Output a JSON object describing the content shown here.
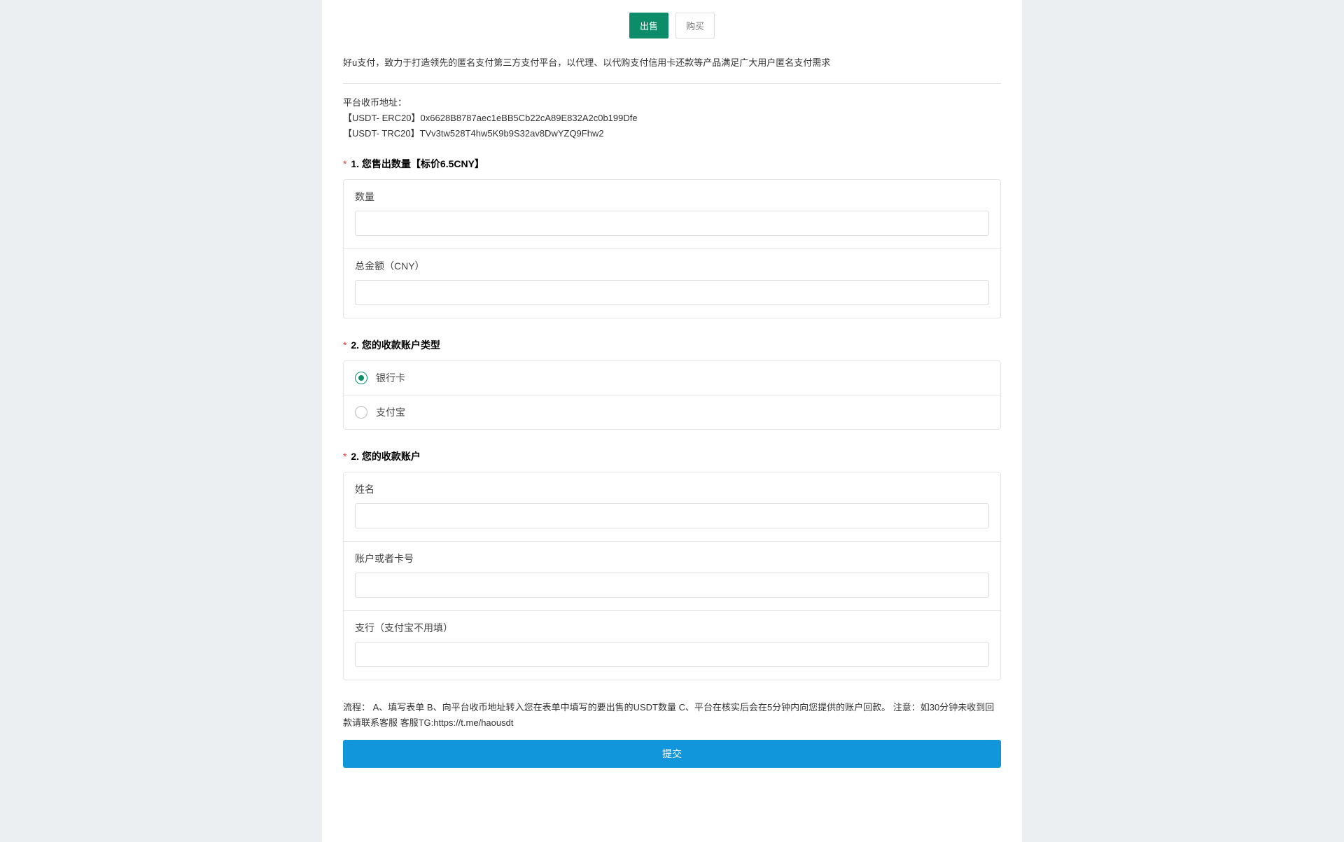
{
  "tabs": {
    "sell": "出售",
    "buy": "购买"
  },
  "intro": "好u支付，致力于打造领先的匿名支付第三方支付平台，以代理、以代购支付信用卡还款等产品满足广大用户匿名支付需求",
  "address": {
    "title": "平台收币地址：",
    "line1": "【USDT- ERC20】0x6628B8787aec1eBB5Cb22cA89E832A2c0b199Dfe",
    "line2": "【USDT- TRC20】TVv3tw528T4hw5K9b9S32av8DwYZQ9Fhw2"
  },
  "sections": {
    "s1": {
      "title": "1. 您售出数量【标价6.5CNY】",
      "fields": {
        "qty": "数量",
        "total": "总金额（CNY）"
      }
    },
    "s2": {
      "title": "2. 您的收款账户类型",
      "options": {
        "bank": "银行卡",
        "alipay": "支付宝"
      }
    },
    "s3": {
      "title": "2. 您的收款账户",
      "fields": {
        "name": "姓名",
        "account": "账户或者卡号",
        "branch": "支行（支付宝不用填）"
      }
    }
  },
  "footer": "流程： A、填写表单 B、向平台收币地址转入您在表单中填写的要出售的USDT数量 C、平台在核实后会在5分钟内向您提供的账户回款。 注意：如30分钟未收到回款请联系客服 客服TG:https://t.me/haousdt",
  "submit": "提交"
}
